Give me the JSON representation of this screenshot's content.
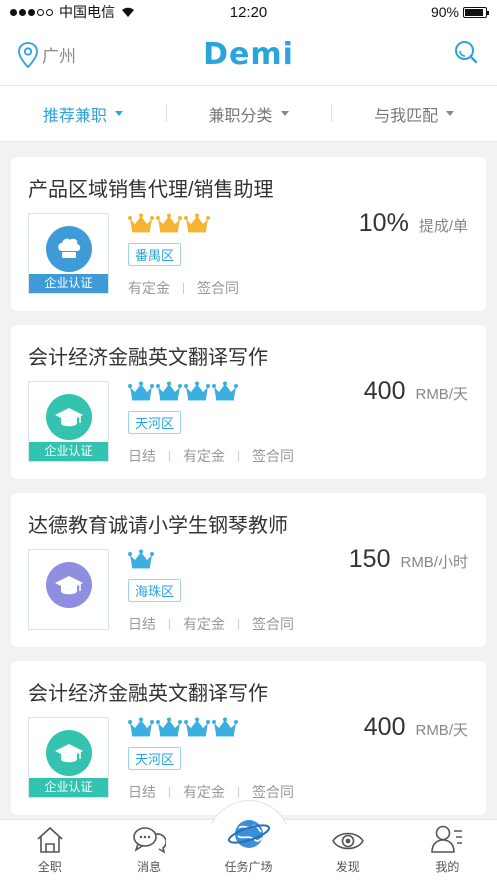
{
  "status_bar": {
    "carrier": "中国电信",
    "time": "12:20",
    "battery": "90%",
    "battery_level": 0.9
  },
  "nav": {
    "city": "广州",
    "logo": "Demi"
  },
  "filters": [
    {
      "label": "推荐兼职",
      "active": true
    },
    {
      "label": "兼职分类",
      "active": false
    },
    {
      "label": "与我匹配",
      "active": false
    }
  ],
  "jobs": [
    {
      "title": "产品区域销售代理/销售助理",
      "crown_count": 3,
      "crown_color": "#f5b432",
      "district": "番禺区",
      "tags": [
        "有定金",
        "签合同"
      ],
      "price": "10%",
      "unit": "提成/单",
      "badge": "企业认证",
      "logo_icon": "chef-hat-icon",
      "logo_color": "#3f9ad8",
      "badge_color": "#3f9ad8"
    },
    {
      "title": "会计经济金融英文翻译写作",
      "crown_count": 4,
      "crown_color": "#3bb0e0",
      "district": "天河区",
      "tags": [
        "日结",
        "有定金",
        "签合同"
      ],
      "price": "400",
      "unit": "RMB/天",
      "badge": "企业认证",
      "logo_icon": "graduation-cap-icon",
      "logo_color": "#33c3b0",
      "badge_color": "#33c3b0"
    },
    {
      "title": "达德教育诚请小学生钢琴教师",
      "crown_count": 1,
      "crown_color": "#3bb0e0",
      "district": "海珠区",
      "tags": [
        "日结",
        "有定金",
        "签合同"
      ],
      "price": "150",
      "unit": "RMB/小时",
      "badge": "",
      "logo_icon": "graduation-cap-icon",
      "logo_color": "#8f8ee0",
      "badge_color": ""
    },
    {
      "title": "会计经济金融英文翻译写作",
      "crown_count": 4,
      "crown_color": "#3bb0e0",
      "district": "天河区",
      "tags": [
        "日结",
        "有定金",
        "签合同"
      ],
      "price": "400",
      "unit": "RMB/天",
      "badge": "企业认证",
      "logo_icon": "graduation-cap-icon",
      "logo_color": "#33c3b0",
      "badge_color": "#33c3b0"
    }
  ],
  "tabs": [
    {
      "label": "全职",
      "icon": "house-icon"
    },
    {
      "label": "消息",
      "icon": "chat-icon"
    },
    {
      "label": "任务广场",
      "icon": "globe-icon"
    },
    {
      "label": "发现",
      "icon": "eye-icon"
    },
    {
      "label": "我的",
      "icon": "user-icon"
    }
  ]
}
